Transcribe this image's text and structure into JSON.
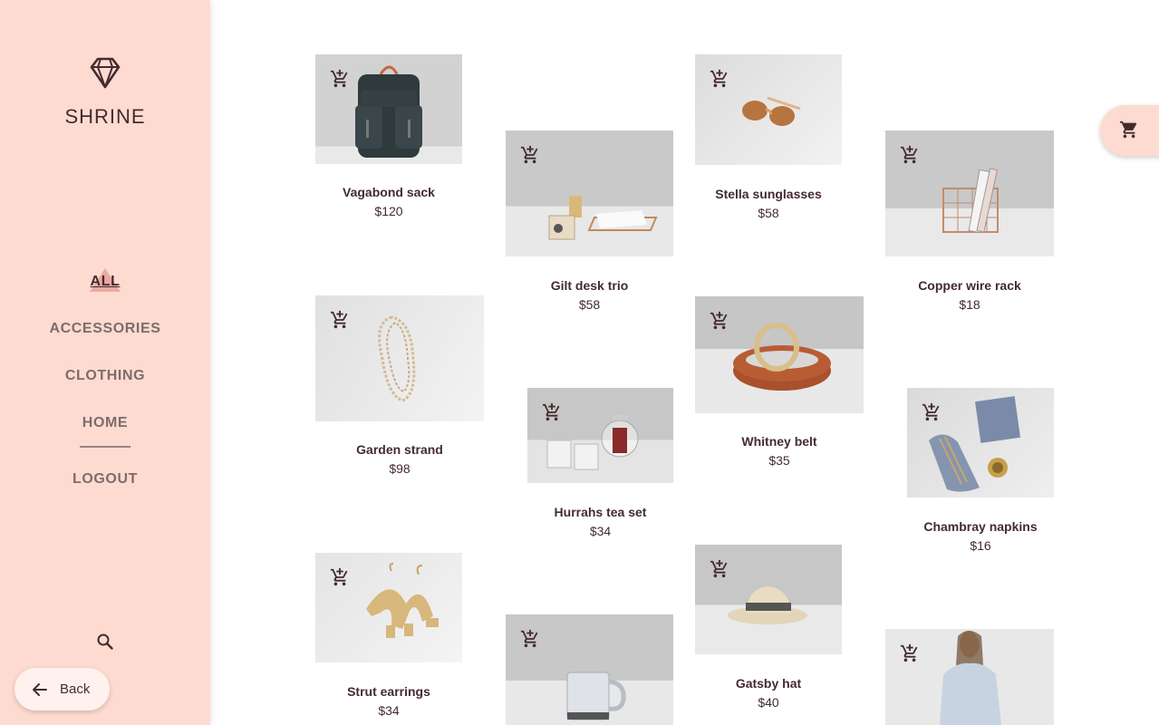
{
  "brand": {
    "name": "SHRINE",
    "logo_icon": "diamond-icon"
  },
  "nav": {
    "items": [
      {
        "label": "ALL",
        "active": true
      },
      {
        "label": "ACCESSORIES",
        "active": false
      },
      {
        "label": "CLOTHING",
        "active": false
      },
      {
        "label": "HOME",
        "active": false
      },
      {
        "label": "LOGOUT",
        "active": false
      }
    ]
  },
  "search_icon": "search-icon",
  "back": {
    "label": "Back",
    "icon": "arrow-back-icon"
  },
  "cart_icon": "shopping-cart-icon",
  "colors": {
    "sidebar": "#fedbd0",
    "text": "#442b2d",
    "accent": "#e29a96"
  },
  "products": [
    {
      "name": "Vagabond sack",
      "price": "$120"
    },
    {
      "name": "Gilt desk trio",
      "price": "$58"
    },
    {
      "name": "Stella sunglasses",
      "price": "$58"
    },
    {
      "name": "Copper wire rack",
      "price": "$18"
    },
    {
      "name": "Garden strand",
      "price": "$98"
    },
    {
      "name": "Hurrahs tea set",
      "price": "$34"
    },
    {
      "name": "Whitney belt",
      "price": "$35"
    },
    {
      "name": "Chambray napkins",
      "price": "$16"
    },
    {
      "name": "Strut earrings",
      "price": "$34"
    },
    {
      "name": "",
      "price": ""
    },
    {
      "name": "Gatsby hat",
      "price": "$40"
    },
    {
      "name": "",
      "price": ""
    }
  ]
}
